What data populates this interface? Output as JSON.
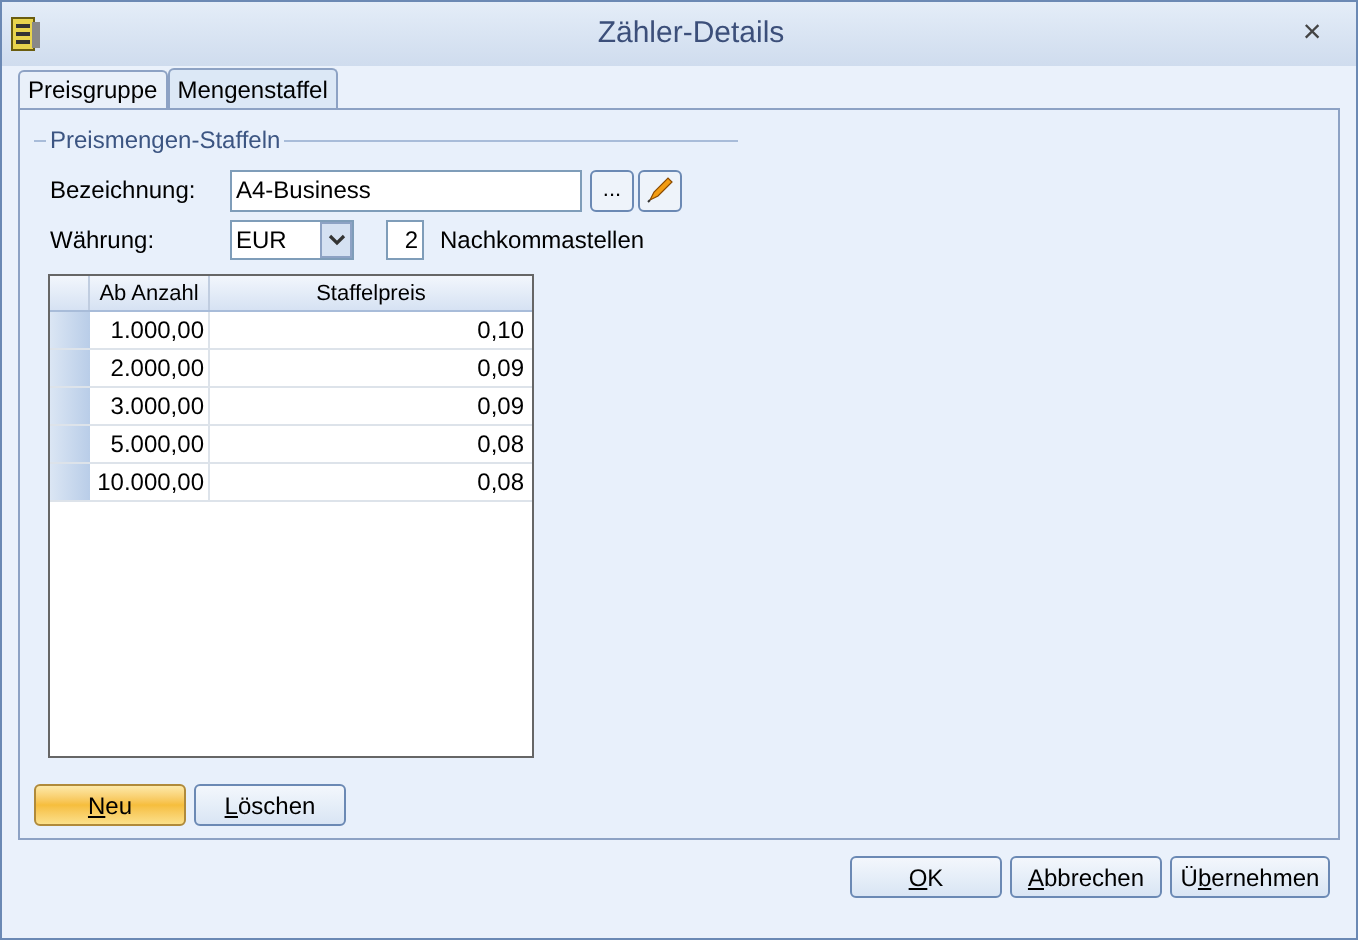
{
  "window": {
    "title": "Zähler-Details",
    "close": "×"
  },
  "tabs": [
    {
      "label": "Preisgruppe",
      "selected": false
    },
    {
      "label": "Mengenstaffel",
      "selected": true
    }
  ],
  "group": {
    "title": "Preismengen-Staffeln"
  },
  "bezeichnung": {
    "label": "Bezeichnung:",
    "value": "A4-Business",
    "browse": "..."
  },
  "waehrung": {
    "label": "Währung:",
    "value": "EUR",
    "decimals": "2",
    "decimals_label": "Nachkommastellen"
  },
  "table": {
    "columns": [
      "Ab Anzahl",
      "Staffelpreis"
    ],
    "rows": [
      [
        "1.000,00",
        "0,10"
      ],
      [
        "2.000,00",
        "0,09"
      ],
      [
        "3.000,00",
        "0,09"
      ],
      [
        "5.000,00",
        "0,08"
      ],
      [
        "10.000,00",
        "0,08"
      ]
    ]
  },
  "grid_buttons": [
    {
      "label": [
        {
          "text": "N",
          "underline": true
        },
        {
          "text": "eu",
          "underline": false
        }
      ],
      "kind": "primary"
    },
    {
      "label": [
        {
          "text": "L",
          "underline": true
        },
        {
          "text": "öschen",
          "underline": false
        }
      ],
      "kind": "normal"
    }
  ],
  "dialog_buttons": [
    {
      "label": [
        {
          "text": "O",
          "underline": true
        },
        {
          "text": "K",
          "underline": false
        }
      ]
    },
    {
      "label": [
        {
          "text": "A",
          "underline": true
        },
        {
          "text": "bbrechen",
          "underline": false
        }
      ]
    },
    {
      "label": [
        {
          "text": "Ü",
          "underline": false
        },
        {
          "text": "b",
          "underline": true
        },
        {
          "text": "ernehmen",
          "underline": false
        }
      ]
    }
  ]
}
